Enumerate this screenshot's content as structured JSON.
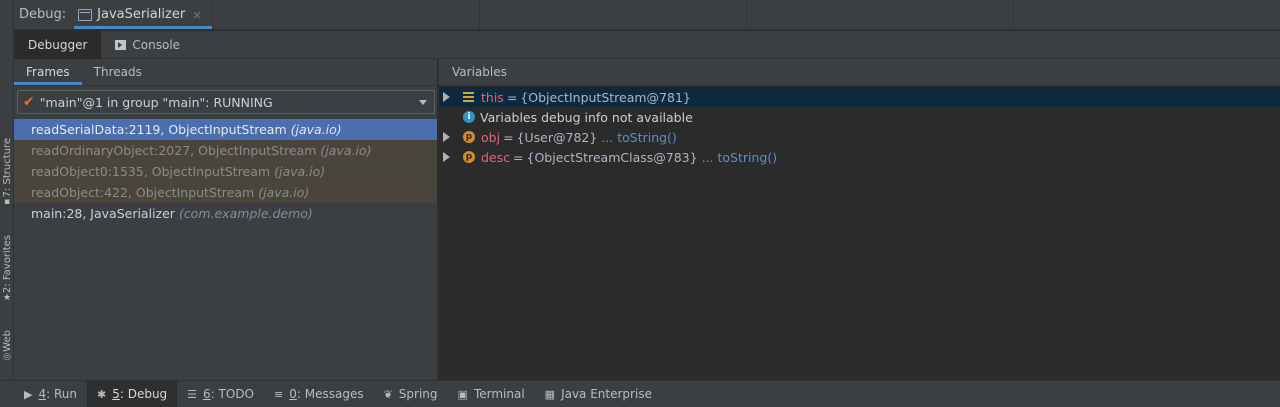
{
  "left_strip": {
    "structure": {
      "label": "7: Structure",
      "icon": "structure-icon"
    },
    "favorites": {
      "label": "2: Favorites",
      "icon": "star-icon"
    },
    "web": {
      "label": "Web",
      "icon": "globe-icon"
    }
  },
  "header": {
    "debug_label": "Debug:",
    "run_tab": {
      "title": "JavaSerializer",
      "close": "×",
      "icon": "run-config-icon"
    }
  },
  "sub_tabs": [
    {
      "label": "Debugger",
      "active": true
    },
    {
      "label": "Console",
      "active": false,
      "icon": "console-icon"
    }
  ],
  "frames_panel": {
    "tabs": [
      {
        "label": "Frames",
        "active": true
      },
      {
        "label": "Threads",
        "active": false
      }
    ],
    "thread_select": {
      "value": "\"main\"@1 in group \"main\": RUNNING",
      "icon": "check-icon"
    },
    "frames": [
      {
        "method": "readSerialData:2119, ObjectInputStream",
        "pkg": "(java.io)",
        "style": "selected"
      },
      {
        "method": "readOrdinaryObject:2027, ObjectInputStream",
        "pkg": "(java.io)",
        "style": "lib"
      },
      {
        "method": "readObject0:1535, ObjectInputStream",
        "pkg": "(java.io)",
        "style": "lib"
      },
      {
        "method": "readObject:422, ObjectInputStream",
        "pkg": "(java.io)",
        "style": "lib"
      },
      {
        "method": "main:28, JavaSerializer",
        "pkg": "(com.example.demo)",
        "style": "normal"
      }
    ]
  },
  "variables_panel": {
    "title": "Variables",
    "this_var": {
      "name": "this",
      "eq": "=",
      "value": "{ObjectInputStream@781}"
    },
    "info": {
      "text": "Variables debug info not available"
    },
    "obj_var": {
      "name": "obj",
      "eq": "=",
      "value": "{User@782}",
      "link": "... toString()"
    },
    "desc_var": {
      "name": "desc",
      "eq": "=",
      "value": "{ObjectStreamClass@783}",
      "link": "... toString()"
    }
  },
  "bottom_bar": {
    "run": {
      "num": "4",
      "label": ": Run"
    },
    "debug": {
      "num": "5",
      "label": ": Debug"
    },
    "todo": {
      "num": "6",
      "label": ": TODO"
    },
    "messages": {
      "num": "0",
      "label": ": Messages"
    },
    "spring": {
      "label": "Spring"
    },
    "terminal": {
      "label": "Terminal"
    },
    "java_enterprise": {
      "label": "Java Enterprise"
    }
  }
}
